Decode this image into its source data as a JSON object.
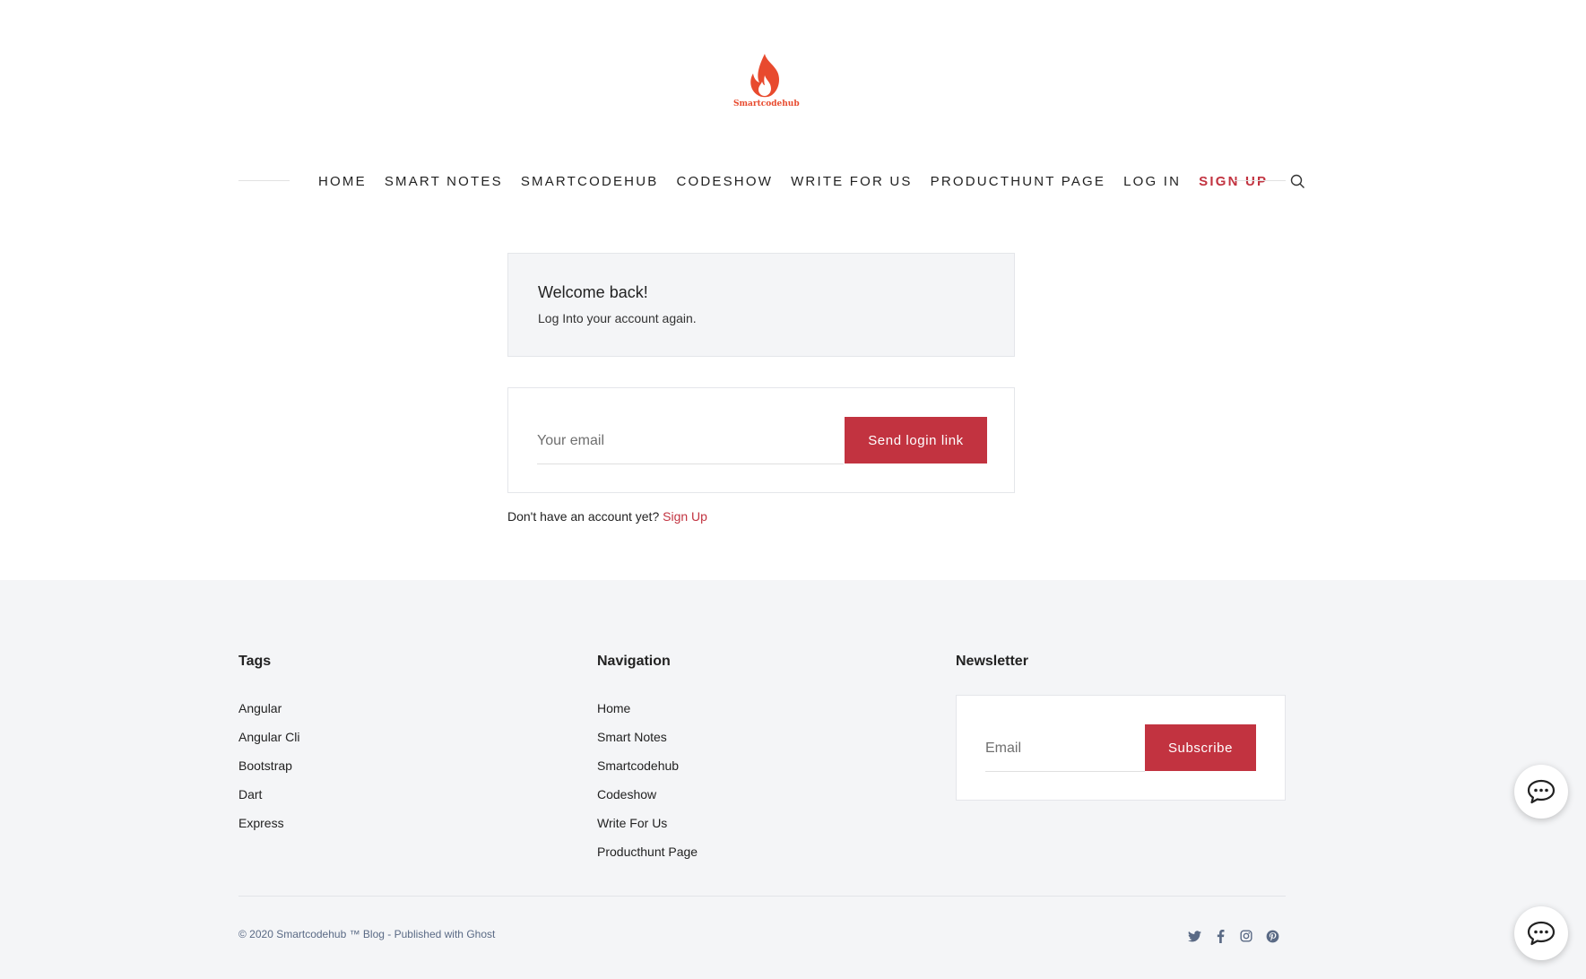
{
  "brand": {
    "name": "Smartcodehub",
    "logo_color": "#e84a2e"
  },
  "nav": {
    "items": [
      {
        "label": "Home"
      },
      {
        "label": "Smart Notes"
      },
      {
        "label": "Smartcodehub"
      },
      {
        "label": "Codeshow"
      },
      {
        "label": "Write For Us"
      },
      {
        "label": "Producthunt Page"
      },
      {
        "label": "Log In"
      }
    ],
    "signup": "Sign Up",
    "search_icon": "search-icon"
  },
  "welcome": {
    "title": "Welcome back!",
    "subtitle": "Log Into your account again."
  },
  "login": {
    "email_placeholder": "Your email",
    "button": "Send login link"
  },
  "signup_prompt": {
    "text": "Don't have an account yet?",
    "link": "Sign Up"
  },
  "footer": {
    "tags": {
      "title": "Tags",
      "items": [
        "Angular",
        "Angular Cli",
        "Bootstrap",
        "Dart",
        "Express"
      ]
    },
    "navigation": {
      "title": "Navigation",
      "items": [
        "Home",
        "Smart Notes",
        "Smartcodehub",
        "Codeshow",
        "Write For Us",
        "Producthunt Page"
      ]
    },
    "newsletter": {
      "title": "Newsletter",
      "email_placeholder": "Email",
      "button": "Subscribe"
    },
    "copyright": "© 2020 Smartcodehub ™ Blog - Published with Ghost",
    "socials": [
      "twitter-icon",
      "facebook-icon",
      "instagram-icon",
      "pinterest-icon"
    ]
  },
  "colors": {
    "accent": "#c23340",
    "footer_bg": "#f4f5f7",
    "social": "#5a6a85"
  }
}
